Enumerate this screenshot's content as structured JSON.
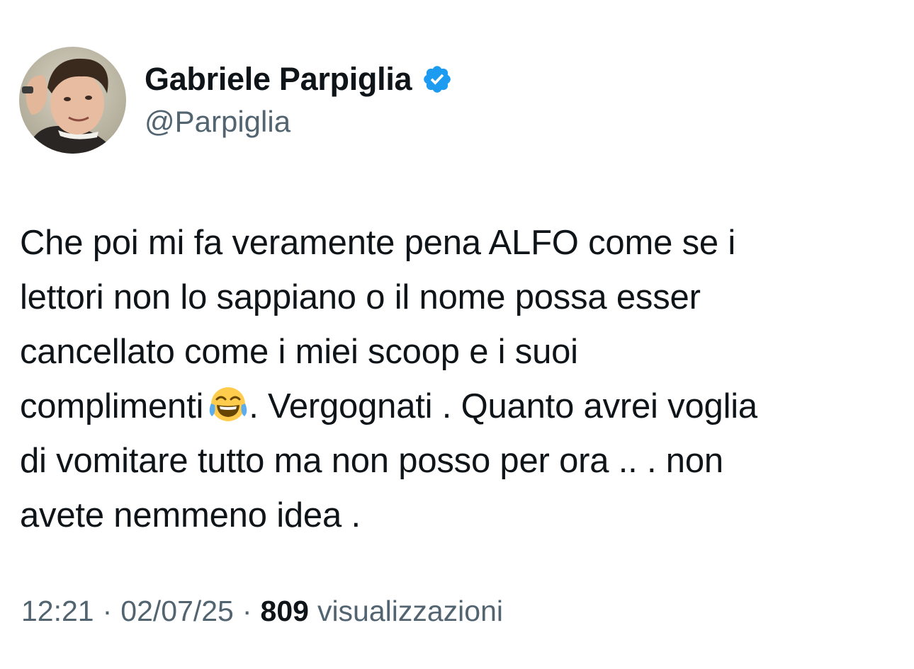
{
  "author": {
    "display_name": "Gabriele Parpiglia",
    "handle": "@Parpiglia",
    "verified": true,
    "verified_color": "#1d9bf0"
  },
  "tweet": {
    "lines": [
      "Che poi mi fa veramente pena ALFO come se i",
      "lettori non lo sappiano o il nome possa esser",
      "cancellato come i miei scoop e i suoi",
      "complimenti",
      ". Vergognati . Quanto avrei voglia",
      "di vomitare tutto ma non posso per ora .. . non",
      "avete nemmeno idea ."
    ],
    "emoji": "face-with-tears-of-joy-icon"
  },
  "meta": {
    "time": "12:21",
    "separator": "·",
    "date": "02/07/25",
    "views_count": "809",
    "views_label": "visualizzazioni"
  },
  "colors": {
    "text": "#0f1419",
    "secondary": "#536471",
    "background": "#ffffff"
  }
}
